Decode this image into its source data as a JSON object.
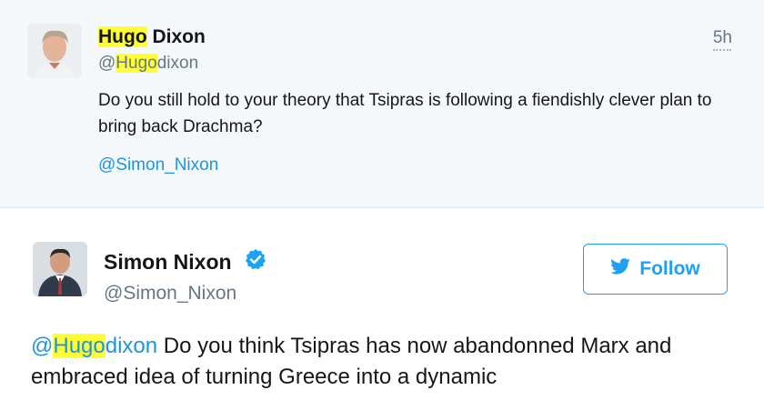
{
  "parent_tweet": {
    "name_highlight": "Hugo",
    "name_rest": " Dixon",
    "handle_at": "@",
    "handle_highlight": "Hugo",
    "handle_rest": "dixon",
    "time": "5h",
    "text": "Do you still hold to your theory that Tsipras is following a fiendishly clever plan to bring back Drachma?",
    "mention": "@Simon_Nixon"
  },
  "reply_tweet": {
    "name": "Simon Nixon",
    "verified": true,
    "handle": "@Simon_Nixon",
    "follow_label": "Follow",
    "mention_at": "@",
    "mention_highlight": "Hugo",
    "mention_rest": "dixon",
    "text": " Do you think Tsipras has now abandonned Marx and embraced idea of turning Greece into a dynamic"
  },
  "colors": {
    "link": "#1b95e0",
    "follow_blue": "#1da1f2",
    "highlight": "#ffff33",
    "muted": "#657786",
    "parent_bg": "#f5f8fa"
  },
  "icons": [
    "hugo-avatar",
    "simon-avatar",
    "verified-badge-icon",
    "twitter-bird-icon",
    "dots-icon"
  ]
}
